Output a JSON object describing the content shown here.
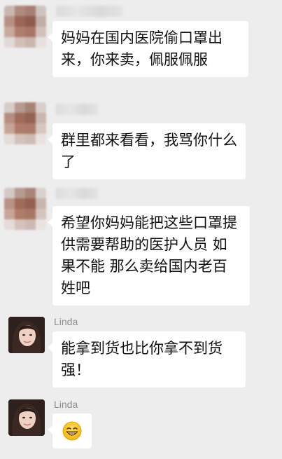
{
  "messages": [
    {
      "sender": "",
      "text": "妈妈在国内医院偷口罩出来，你来卖，佩服佩服"
    },
    {
      "sender": "",
      "text": "群里都来看看，我骂你什么了"
    },
    {
      "sender": "",
      "text": " 希望你妈妈能把这些口罩提供需要帮助的医护人员 如果不能 那么卖给国内老百姓吧"
    },
    {
      "sender": "Linda",
      "text": "能拿到货也比你拿不到货强！"
    },
    {
      "sender": "Linda",
      "emoji": "grinning-face-icon"
    }
  ],
  "colors": {
    "background": "#ededed",
    "bubble": "#ffffff",
    "text": "#111111",
    "sender": "#8c8c8c"
  }
}
